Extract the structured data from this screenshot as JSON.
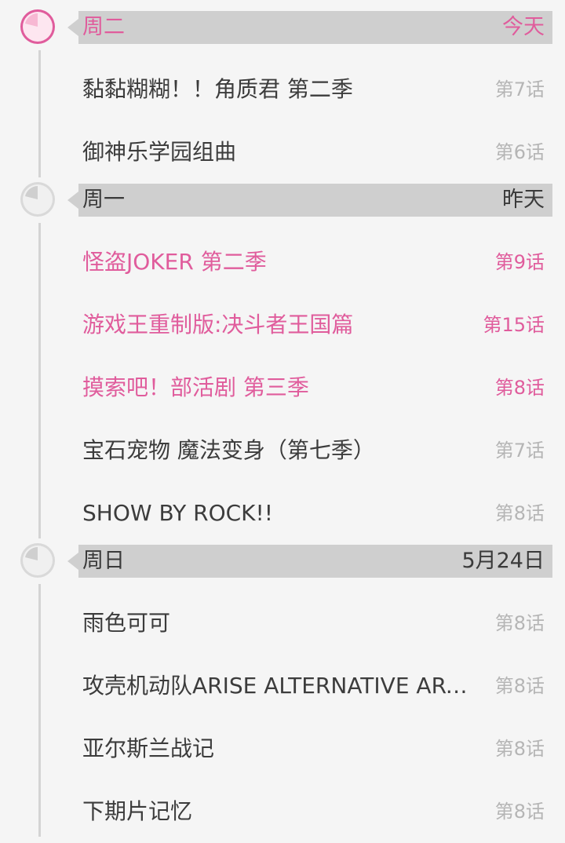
{
  "colors": {
    "accent": "#e05c9c",
    "header_bg": "#cfcfcf",
    "text": "#3c3c3c",
    "muted": "#b5b5b5"
  },
  "sections": [
    {
      "day": "周二",
      "date": "今天",
      "today": true,
      "clock_icon": "clock-icon",
      "items": [
        {
          "title": "黏黏糊糊！！角质君 第二季",
          "episode": "第7话",
          "highlight": false
        },
        {
          "title": "御神乐学园组曲",
          "episode": "第6话",
          "highlight": false
        }
      ]
    },
    {
      "day": "周一",
      "date": "昨天",
      "today": false,
      "clock_icon": "clock-icon",
      "items": [
        {
          "title": "怪盗JOKER 第二季",
          "episode": "第9话",
          "highlight": true
        },
        {
          "title": "游戏王重制版:决斗者王国篇",
          "episode": "第15话",
          "highlight": true
        },
        {
          "title": "摸索吧！部活剧 第三季",
          "episode": "第8话",
          "highlight": true
        },
        {
          "title": "宝石宠物 魔法变身（第七季）",
          "episode": "第7话",
          "highlight": false
        },
        {
          "title": "SHOW BY ROCK!!",
          "episode": "第8话",
          "highlight": false
        }
      ]
    },
    {
      "day": "周日",
      "date": "5月24日",
      "today": false,
      "clock_icon": "clock-icon",
      "items": [
        {
          "title": "雨色可可",
          "episode": "第8话",
          "highlight": false
        },
        {
          "title": "攻壳机动队ARISE ALTERNATIVE ARCHITECTURE",
          "episode": "第8话",
          "highlight": false
        },
        {
          "title": "亚尔斯兰战记",
          "episode": "第8话",
          "highlight": false
        },
        {
          "title": "下期片记忆",
          "episode": "第8话",
          "highlight": false
        }
      ]
    }
  ]
}
